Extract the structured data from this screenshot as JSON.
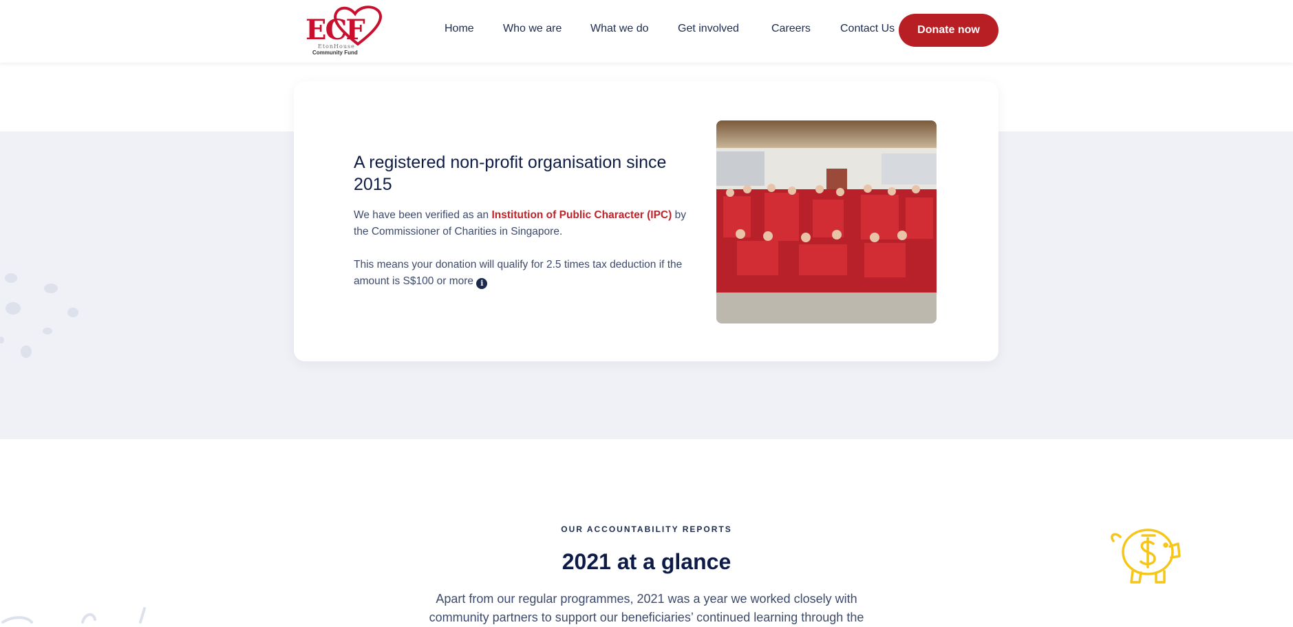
{
  "logo": {
    "letters": "ECF",
    "line1": "EtonHouse",
    "line2": "Community Fund"
  },
  "nav": {
    "items": [
      "Home",
      "Who we are",
      "What we do",
      "Get involved",
      "Careers",
      "Contact Us"
    ],
    "donate": "Donate now"
  },
  "ipc_card": {
    "heading": "A registered non-profit organisation since 2015",
    "p1_before": "We have been verified as an ",
    "p1_link": "Institution of Public Character (IPC)",
    "p1_after": " by the Commissioner of Charities in Singapore.",
    "p2": "This means your donation will qualify for 2.5 times tax deduction if the amount is S$100 or more",
    "info_icon": "info-icon"
  },
  "glance": {
    "eyebrow": "OUR ACCOUNTABILITY REPORTS",
    "title": "2021 at a glance",
    "intro": "Apart from our regular programmes, 2021 was a year we worked closely with community partners to support our beneficiaries’ continued learning through the"
  },
  "colors": {
    "brand_red": "#b81f25",
    "navy": "#0d1b46",
    "band_grey": "#eff1f6",
    "piggy_yellow": "#f5c518"
  }
}
